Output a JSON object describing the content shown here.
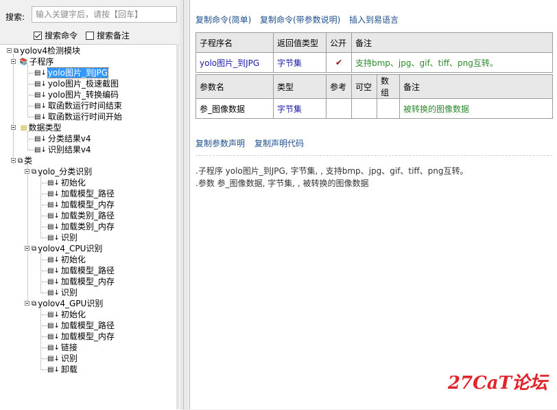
{
  "search": {
    "label": "搜索:",
    "placeholder": "输入关键字后，请按【回车】"
  },
  "filters": {
    "search_command": "搜索命令",
    "search_remark": "搜索备注"
  },
  "tree": {
    "root": "yolov4检测模块",
    "subprograms": "子程序",
    "sub_items": [
      "yolo图片_到JPG",
      "yolo图片_极速截图",
      "yolo图片_转换编码",
      "取函数运行时间结束",
      "取函数运行时间开始"
    ],
    "datatypes": "数据类型",
    "dt_items": [
      "分类结果v4",
      "识别结果v4"
    ],
    "classes": "类",
    "class1": "yolo_分类识别",
    "class1_items": [
      "初始化",
      "加载模型_路径",
      "加载模型_内存",
      "加载类别_路径",
      "加载类别_内存",
      "识别"
    ],
    "class2": "yolov4_CPU识别",
    "class2_items": [
      "初始化",
      "加载模型_路径",
      "加载模型_内存",
      "识别"
    ],
    "class3": "yolov4_GPU识别",
    "class3_items": [
      "初始化",
      "加载模型_路径",
      "加载模型_内存",
      "链接",
      "识别",
      "卸载"
    ]
  },
  "toolbar": {
    "copy_simple": "复制命令(简单)",
    "copy_params": "复制命令(带参数说明)",
    "insert": "插入到易语言"
  },
  "proc_table": {
    "headers": [
      "子程序名",
      "返回值类型",
      "公开",
      "备注"
    ],
    "row": {
      "name": "yolo图片_到JPG",
      "type": "字节集",
      "public": "✔",
      "remark": "支持bmp、jpg、gif、tiff、png互转。"
    }
  },
  "param_table": {
    "headers": [
      "参数名",
      "类型",
      "参考",
      "可空",
      "数组",
      "备注"
    ],
    "row": {
      "name": "参_图像数据",
      "type": "字节集",
      "ref": "",
      "nullable": "",
      "array": "",
      "remark": "被转换的图像数据"
    }
  },
  "links2": {
    "copy_param_decl": "复制参数声明",
    "copy_decl_code": "复制声明代码"
  },
  "decl": {
    "line1": ".子程序 yolo图片_到JPG, 字节集, , 支持bmp、jpg、gif、tiff、png互转。",
    "line2": ".参数 参_图像数据, 字节集, , 被转换的图像数据"
  },
  "watermark": "27CaT论坛"
}
